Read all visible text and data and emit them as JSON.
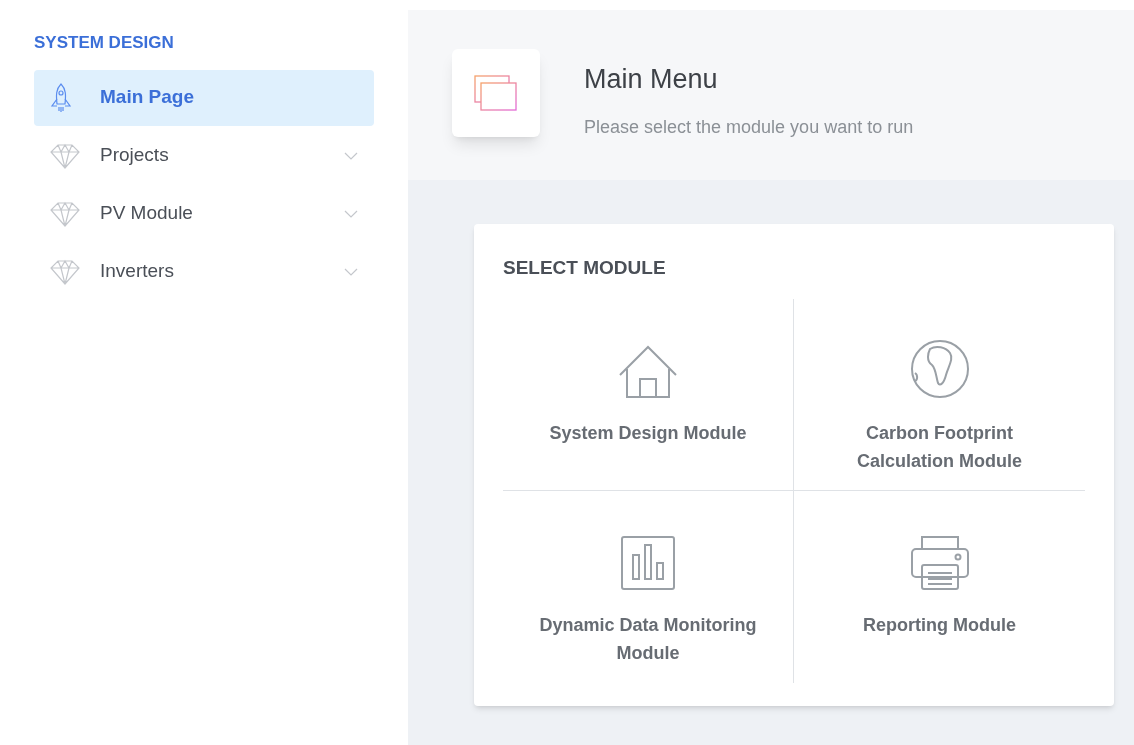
{
  "sidebar": {
    "heading": "SYSTEM DESIGN",
    "items": [
      {
        "label": "Main Page",
        "kind": "rocket",
        "selected": true,
        "expandable": false
      },
      {
        "label": "Projects",
        "kind": "diamond",
        "selected": false,
        "expandable": true
      },
      {
        "label": "PV Module",
        "kind": "diamond",
        "selected": false,
        "expandable": true
      },
      {
        "label": "Inverters",
        "kind": "diamond",
        "selected": false,
        "expandable": true
      }
    ]
  },
  "header": {
    "title": "Main Menu",
    "subtitle": "Please select the module you want to run"
  },
  "module_panel": {
    "title": "SELECT MODULE",
    "modules": [
      {
        "label": "System Design Module",
        "kind": "house"
      },
      {
        "label": "Carbon Footprint Calculation Module",
        "kind": "globe"
      },
      {
        "label": "Dynamic Data Monitoring Module",
        "kind": "chart"
      },
      {
        "label": "Reporting Module",
        "kind": "printer"
      }
    ]
  }
}
